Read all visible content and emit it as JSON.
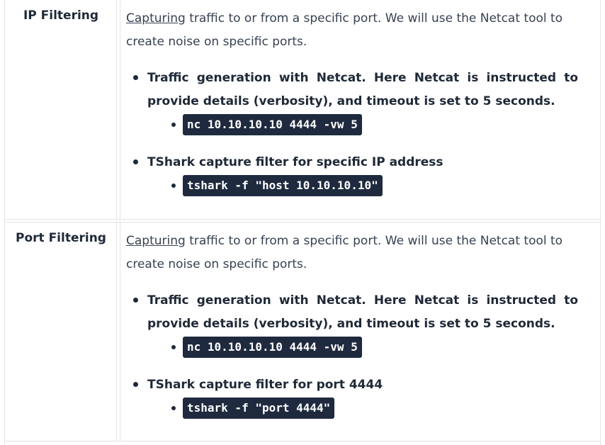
{
  "rows": [
    {
      "name": "IP Filtering",
      "intro_link": "Capturing",
      "intro_rest": " traffic to or from a specific port. We will use the Netcat tool to create noise on specific ports.",
      "bullets": [
        {
          "text": "Traffic generation with Netcat. Here Netcat is instructed to provide details (verbosity), and timeout is set to 5 seconds.",
          "code": "nc 10.10.10.10 4444 -vw 5"
        },
        {
          "text": "TShark capture filter for specific IP address",
          "code": "tshark -f \"host 10.10.10.10\""
        }
      ]
    },
    {
      "name": "Port Filtering",
      "intro_link": "Capturing",
      "intro_rest": " traffic to or from a specific port. We will use the Netcat tool to create noise on specific ports.",
      "bullets": [
        {
          "text": "Traffic generation with Netcat. Here Netcat is instructed to provide details (verbosity), and timeout is set to 5 seconds.",
          "code": "nc 10.10.10.10 4444 -vw 5"
        },
        {
          "text": "TShark capture filter for port 4444",
          "code": "tshark -f \"port 4444\""
        }
      ]
    }
  ],
  "colors": {
    "code_background": "#1f2a3f",
    "code_text": "#ffffff",
    "border": "#e3e3e3",
    "text": "#1f2937"
  }
}
